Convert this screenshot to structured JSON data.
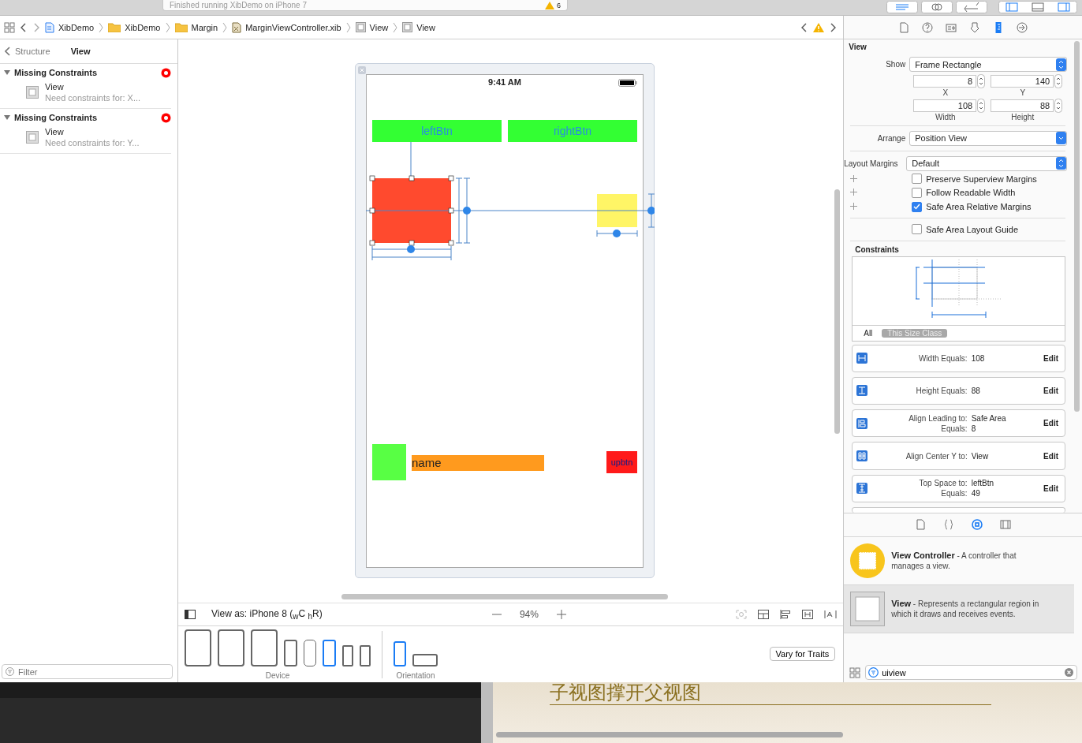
{
  "toolbar": {
    "activity": "Finished running XibDemo on iPhone 7",
    "warning_count": "6"
  },
  "jump_bar": {
    "items": [
      {
        "label": "XibDemo",
        "kind": "project"
      },
      {
        "label": "XibDemo",
        "kind": "folder"
      },
      {
        "label": "Margin",
        "kind": "folder"
      },
      {
        "label": "MarginViewController.xib",
        "kind": "xib"
      },
      {
        "label": "View",
        "kind": "view"
      },
      {
        "label": "View",
        "kind": "view"
      }
    ]
  },
  "issues": {
    "back": "Structure",
    "title": "View",
    "groups": [
      {
        "title": "Missing Constraints",
        "expanded": true,
        "items": [
          {
            "name": "View",
            "detail": "Need constraints for: X..."
          }
        ]
      },
      {
        "title": "Missing Constraints",
        "expanded": true,
        "items": [
          {
            "name": "View",
            "detail": "Need constraints for: Y..."
          }
        ]
      }
    ],
    "filter_placeholder": "Filter"
  },
  "canvas": {
    "status_time": "9:41 AM",
    "top_buttons": [
      "leftBtn",
      "rightBtn"
    ],
    "name_label": "name",
    "small_button": "upbtn"
  },
  "bottom_bar": {
    "view_as": "View as: iPhone 8 ($_{w}$C $_{h}$R)",
    "zoom": "94%",
    "devices": [
      {
        "kind": "ipad",
        "selected": false
      },
      {
        "kind": "ipad",
        "selected": false
      },
      {
        "kind": "ipad",
        "selected": false
      },
      {
        "kind": "phone",
        "selected": false
      },
      {
        "kind": "phonex",
        "selected": false
      },
      {
        "kind": "phone",
        "selected": true
      },
      {
        "kind": "small",
        "selected": false
      },
      {
        "kind": "small",
        "selected": false
      }
    ],
    "device_label": "Device",
    "orientations": [
      {
        "kind": "portrait",
        "selected": true
      },
      {
        "kind": "landscape",
        "selected": false
      }
    ],
    "orientation_label": "Orientation",
    "vary_button": "Vary for Traits"
  },
  "inspector": {
    "tabs": [
      {
        "kind": "file",
        "selected": false
      },
      {
        "kind": "help",
        "selected": false
      },
      {
        "kind": "identity",
        "selected": false
      },
      {
        "kind": "attributes",
        "selected": false
      },
      {
        "kind": "size",
        "selected": true
      },
      {
        "kind": "connections",
        "selected": false
      }
    ],
    "section": "View",
    "show_label": "Show",
    "show_value": "Frame Rectangle",
    "fields": [
      {
        "value": "8",
        "label": "X"
      },
      {
        "value": "140",
        "label": "Y"
      },
      {
        "value": "108",
        "label": "Width"
      },
      {
        "value": "88",
        "label": "Height"
      }
    ],
    "arrange_label": "Arrange",
    "arrange_value": "Position View",
    "margins_label": "Layout Margins",
    "margins_value": "Default",
    "checkboxes": [
      {
        "label": "Preserve Superview Margins",
        "checked": false,
        "plus": true
      },
      {
        "label": "Follow Readable Width",
        "checked": false,
        "plus": true
      },
      {
        "label": "Safe Area Relative Margins",
        "checked": true,
        "plus": true
      },
      {
        "label": "Safe Area Layout Guide",
        "checked": false,
        "plus": false
      }
    ],
    "constraints_title": "Constraints",
    "scopes": [
      {
        "label": "All",
        "selected": false
      },
      {
        "label": "This Size Class",
        "selected": true
      }
    ],
    "constraints": [
      {
        "kind": "width",
        "lines": [
          {
            "key": "Width Equals:",
            "value": "108"
          }
        ],
        "edit": "Edit"
      },
      {
        "kind": "height",
        "lines": [
          {
            "key": "Height Equals:",
            "value": "88"
          }
        ],
        "edit": "Edit"
      },
      {
        "kind": "leading",
        "lines": [
          {
            "key": "Align Leading to:",
            "value": "Safe Area"
          },
          {
            "key": "Equals:",
            "value": "8"
          }
        ],
        "edit": "Edit"
      },
      {
        "kind": "centery",
        "lines": [
          {
            "key": "Align Center Y to:",
            "value": "View"
          }
        ],
        "edit": "Edit"
      },
      {
        "kind": "top",
        "lines": [
          {
            "key": "Top Space to:",
            "value": "leftBtn"
          },
          {
            "key": "Equals:",
            "value": "49"
          }
        ],
        "edit": "Edit"
      }
    ]
  },
  "library": {
    "tabs": [
      {
        "kind": "file",
        "selected": false
      },
      {
        "kind": "code",
        "selected": false
      },
      {
        "kind": "object",
        "selected": true
      },
      {
        "kind": "media",
        "selected": false
      }
    ],
    "items": [
      {
        "kind": "controller",
        "title": "View Controller",
        "desc": " - A controller that manages a view.",
        "selected": false
      },
      {
        "kind": "view",
        "title": "View",
        "desc": " - Represents a rectangular region in which it draws and receives events.",
        "selected": true
      }
    ],
    "search": "uiview"
  },
  "video": {
    "caption": "子视图撑开父视图"
  }
}
